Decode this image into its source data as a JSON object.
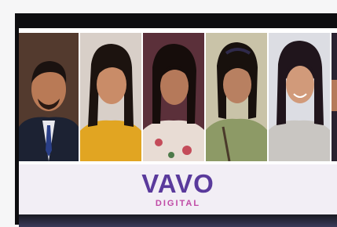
{
  "logo": {
    "word": "VAVO",
    "sub": "DIGITAL",
    "brand_color": "#5a3a9c",
    "accent_color": "#c04aa6"
  },
  "photos": [
    {
      "name": "photo-man-suit"
    },
    {
      "name": "photo-woman-yellow"
    },
    {
      "name": "photo-woman-floral"
    },
    {
      "name": "photo-woman-green"
    },
    {
      "name": "photo-woman-grey"
    },
    {
      "name": "photo-partial"
    }
  ]
}
